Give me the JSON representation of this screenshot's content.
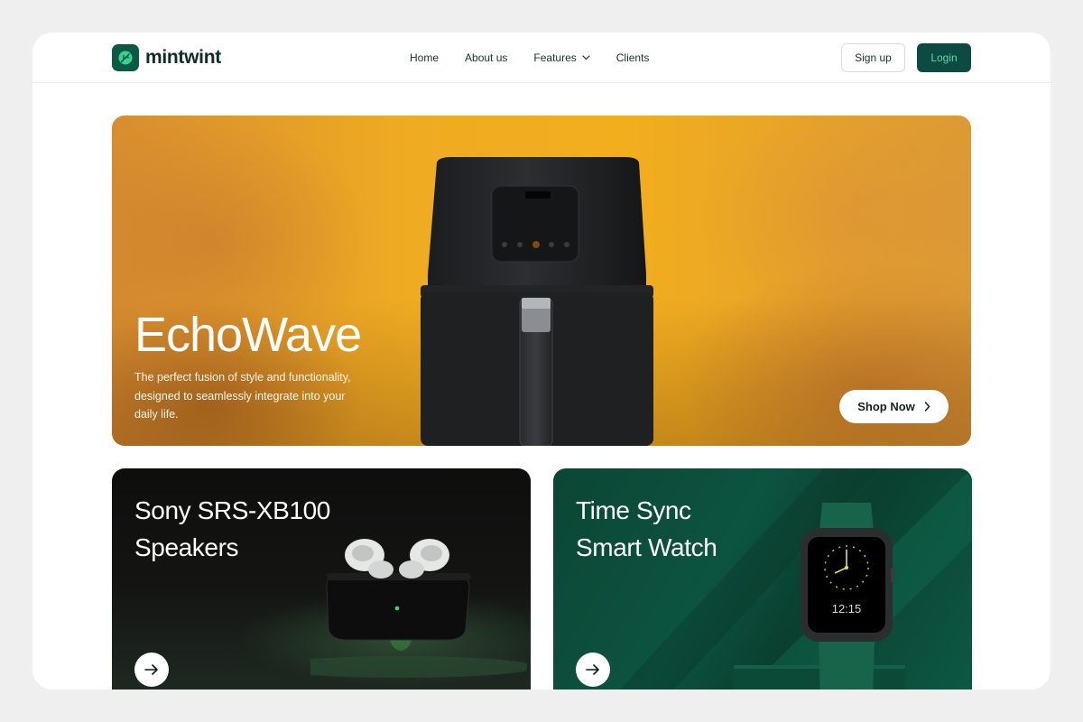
{
  "brand": {
    "name": "mintwint",
    "logo_icon": "leaf-icon",
    "color": "#0c5a45"
  },
  "nav": {
    "items": [
      {
        "label": "Home"
      },
      {
        "label": "About us"
      },
      {
        "label": "Features",
        "icon": "chevron-down-icon"
      },
      {
        "label": "Clients"
      }
    ],
    "signup_label": "Sign up",
    "login_label": "Login"
  },
  "hero": {
    "title": "EchoWave",
    "description": "The perfect fusion of style and functionality, designed to seamlessly integrate into your daily life.",
    "cta_label": "Shop Now",
    "cta_icon": "chevron-right-icon",
    "background_color": "#efac22"
  },
  "cards": [
    {
      "title_line1": "Sony SRS-XB100",
      "title_line2": "Speakers",
      "icon": "arrow-right-icon",
      "background_color": "#111210"
    },
    {
      "title_line1": "Time Sync",
      "title_line2": "Smart Watch",
      "icon": "arrow-right-icon",
      "background_color": "#0c5440",
      "watch_time": "12:15"
    }
  ],
  "colors": {
    "accent": "#0d4a41",
    "login_text": "#5fd9a6"
  }
}
